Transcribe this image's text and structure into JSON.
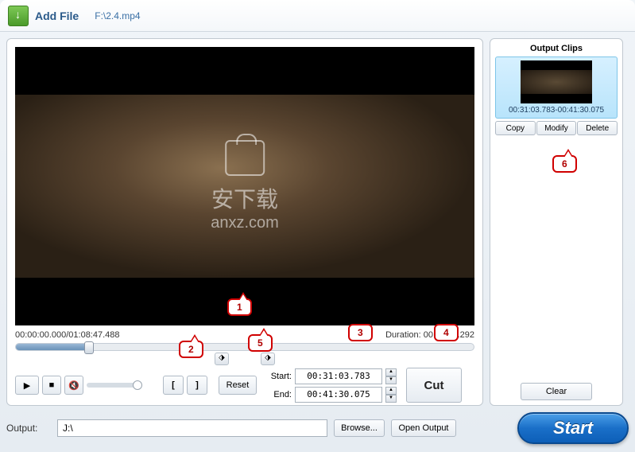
{
  "header": {
    "add_file_label": "Add File",
    "file_path": "F:\\2.4.mp4"
  },
  "player": {
    "time_info": "00:00:00.000/01:08:47.488",
    "duration_label": "Duration:",
    "duration_value": "00:10:26.292"
  },
  "watermark": {
    "text": "安下载",
    "url": "anxz.com"
  },
  "controls": {
    "reset_label": "Reset",
    "start_label": "Start:",
    "end_label": "End:",
    "start_value": "00:31:03.783",
    "end_value": "00:41:30.075",
    "cut_label": "Cut"
  },
  "annotations": {
    "n1": "1",
    "n2": "2",
    "n3": "3",
    "n4": "4",
    "n5": "5",
    "n6": "6"
  },
  "output_clips": {
    "title": "Output Clips",
    "clip_time": "00:31:03.783-00:41:30.075",
    "copy_label": "Copy",
    "modify_label": "Modify",
    "delete_label": "Delete",
    "clear_label": "Clear"
  },
  "bottom": {
    "output_label": "Output:",
    "output_path": "J:\\",
    "browse_label": "Browse...",
    "open_output_label": "Open Output",
    "start_label": "Start"
  }
}
